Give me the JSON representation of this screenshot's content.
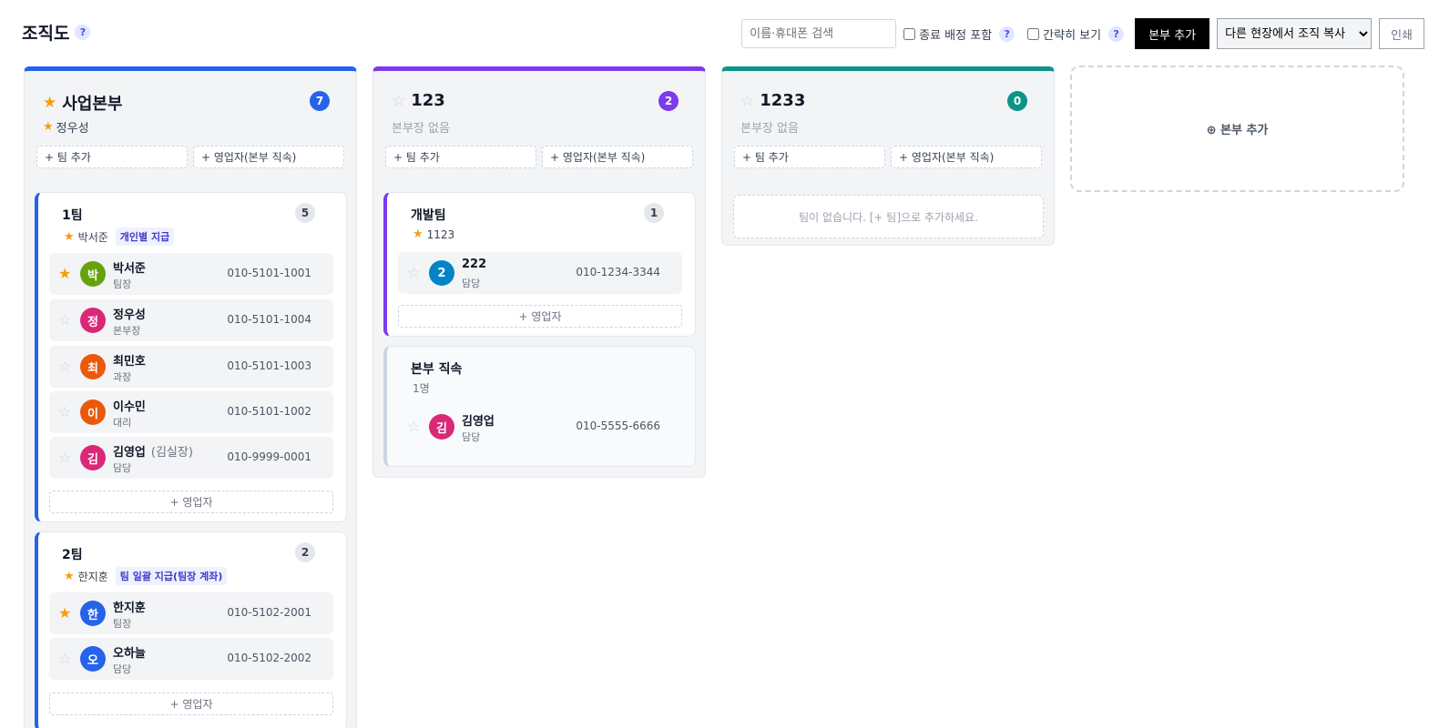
{
  "header": {
    "title": "조직도",
    "help": "?",
    "search_placeholder": "이름·휴대폰 검색",
    "include_ended_label": "종료 배정 포함",
    "compact_label": "간략히 보기",
    "add_division_label": "본부 추가",
    "copy_select_value": "다른 현장에서 조직 복사",
    "print_label": "인쇄"
  },
  "colors": {
    "blue": "#2563eb",
    "violet": "#7c3aed",
    "teal": "#0d9488",
    "star": "#f59e0b"
  },
  "actions": {
    "add_team": "+ 팀 추가",
    "add_direct": "+ 영업자(본부 직속)",
    "add_member": "+ 영업자",
    "add_division_card": "⊕ 본부 추가"
  },
  "divisions": [
    {
      "name": "사업본부",
      "count": "7",
      "lead_name": "정우성",
      "teams": [
        {
          "name": "1팀",
          "count": "5",
          "lead": "박서준",
          "pay": "개인별 지급",
          "members": [
            {
              "initial": "박",
              "name": "박서준",
              "nick": "",
              "role": "팀장",
              "phone": "010-5101-1001",
              "starred": true,
              "color": "#65a30d"
            },
            {
              "initial": "정",
              "name": "정우성",
              "nick": "",
              "role": "본부장",
              "phone": "010-5101-1004",
              "starred": false,
              "color": "#db2777"
            },
            {
              "initial": "최",
              "name": "최민호",
              "nick": "",
              "role": "과장",
              "phone": "010-5101-1003",
              "starred": false,
              "color": "#ea580c"
            },
            {
              "initial": "이",
              "name": "이수민",
              "nick": "",
              "role": "대리",
              "phone": "010-5101-1002",
              "starred": false,
              "color": "#ea580c"
            },
            {
              "initial": "김",
              "name": "김영업",
              "nick": "(김실장)",
              "role": "담당",
              "phone": "010-9999-0001",
              "starred": false,
              "color": "#db2777"
            }
          ]
        },
        {
          "name": "2팀",
          "count": "2",
          "lead": "한지훈",
          "pay": "팀 일괄 지급(팀장 계좌)",
          "members": [
            {
              "initial": "한",
              "name": "한지훈",
              "nick": "",
              "role": "팀장",
              "phone": "010-5102-2001",
              "starred": true,
              "color": "#2563eb"
            },
            {
              "initial": "오",
              "name": "오하늘",
              "nick": "",
              "role": "담당",
              "phone": "010-5102-2002",
              "starred": false,
              "color": "#2563eb"
            }
          ]
        }
      ]
    },
    {
      "name": "123",
      "count": "2",
      "no_lead": "본부장 없음",
      "teams": [
        {
          "name": "개발팀",
          "count": "1",
          "lead": "1123",
          "members": [
            {
              "initial": "2",
              "name": "222",
              "role": "담당",
              "phone": "010-1234-3344",
              "starred": false,
              "color": "#0284c7"
            }
          ]
        }
      ],
      "direct": {
        "title": "본부 직속",
        "sub": "1명",
        "members": [
          {
            "initial": "김",
            "name": "김영업",
            "role": "담당",
            "phone": "010-5555-6666",
            "starred": false,
            "color": "#db2777"
          }
        ]
      }
    },
    {
      "name": "1233",
      "count": "0",
      "no_lead": "본부장 없음",
      "empty_text": "팀이 없습니다. [+ 팀]으로 추가하세요."
    }
  ]
}
